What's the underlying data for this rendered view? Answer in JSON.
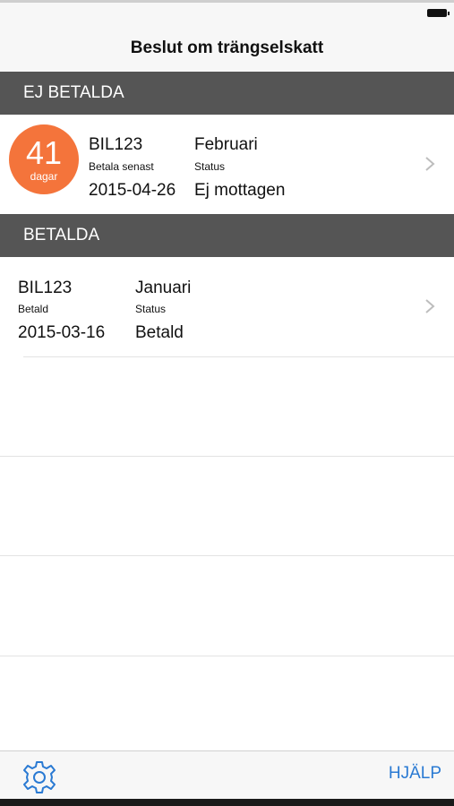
{
  "nav": {
    "title": "Beslut om trängselskatt"
  },
  "unpaid": {
    "header": "EJ BETALDA",
    "items": [
      {
        "days": "41",
        "days_unit": "dagar",
        "plate": "BIL123",
        "date_label": "Betala senast",
        "date": "2015-04-26",
        "month": "Februari",
        "status_label": "Status",
        "status": "Ej mottagen"
      }
    ]
  },
  "paid": {
    "header": "BETALDA",
    "items": [
      {
        "plate": "BIL123",
        "date_label": "Betald",
        "date": "2015-03-16",
        "month": "Januari",
        "status_label": "Status",
        "status": "Betald"
      }
    ]
  },
  "toolbar": {
    "settings_icon": "gear-icon",
    "help_label": "HJÄLP"
  },
  "colors": {
    "accent": "#2a7ad3",
    "badge": "#f4743b",
    "section_header": "#555555"
  }
}
